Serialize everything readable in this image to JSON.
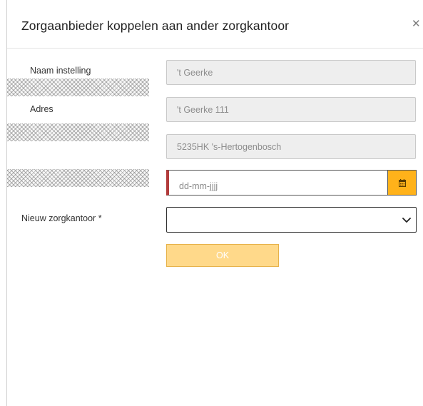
{
  "dialog": {
    "title": "Zorgaanbieder koppelen aan ander zorgkantoor",
    "close_icon": "close-icon"
  },
  "form": {
    "naam_instelling": {
      "label": "Naam instelling",
      "value": "'t Geerke"
    },
    "adres": {
      "label": "Adres",
      "street": "'t Geerke 111",
      "postal_city": "5235HK 's-Hertogenbosch"
    },
    "date": {
      "placeholder": "dd-mm-jjjj",
      "calendar_icon": "calendar-icon"
    },
    "nieuw_zorgkantoor": {
      "label": "Nieuw zorgkantoor *",
      "selected": "",
      "chevron_icon": "chevron-down-icon"
    },
    "ok_label": "OK"
  },
  "colors": {
    "accent": "#ffb21a",
    "ok_button": "#ffd98a",
    "required_marker": "#b23b3b",
    "readonly_field": "#eeeeee"
  }
}
